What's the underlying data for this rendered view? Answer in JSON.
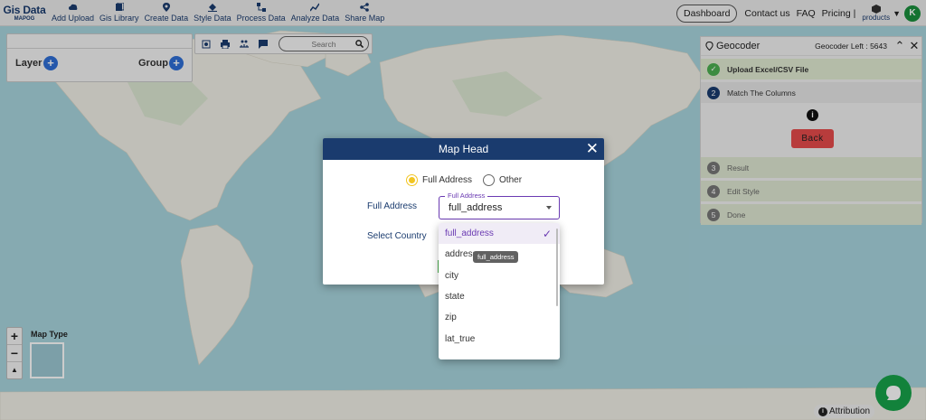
{
  "logo": {
    "line1": "Gis Data",
    "line2": "MAPOG"
  },
  "nav": [
    {
      "label": "Add Upload",
      "icon": "cloud-upload-icon"
    },
    {
      "label": "Gis Library",
      "icon": "library-icon"
    },
    {
      "label": "Create Data",
      "icon": "map-pin-icon"
    },
    {
      "label": "Style Data",
      "icon": "paint-bucket-icon"
    },
    {
      "label": "Process Data",
      "icon": "process-icon"
    },
    {
      "label": "Analyze Data",
      "icon": "analyze-icon"
    },
    {
      "label": "Share Map",
      "icon": "share-icon"
    }
  ],
  "topright": {
    "dashboard": "Dashboard",
    "contact": "Contact us",
    "faq": "FAQ",
    "pricing": "Pricing |",
    "products": "products",
    "avatar": "K"
  },
  "layer_panel": {
    "layer_label": "Layer",
    "group_label": "Group",
    "plus": "+"
  },
  "toolbar": {
    "search_placeholder": "Search"
  },
  "geocoder": {
    "title": "Geocoder",
    "left_label": "Geocoder Left : 5643",
    "steps": [
      {
        "num": "✓",
        "label": "Upload Excel/CSV File",
        "state": "done"
      },
      {
        "num": "2",
        "label": "Match The Columns",
        "state": "active"
      },
      {
        "num": "3",
        "label": "Result",
        "state": "pending"
      },
      {
        "num": "4",
        "label": "Edit Style",
        "state": "pending"
      },
      {
        "num": "5",
        "label": "Done",
        "state": "pending"
      }
    ],
    "info": "i",
    "back_label": "Back"
  },
  "map_controls": {
    "zoom_in": "+",
    "zoom_out": "−",
    "reset": "▲",
    "map_type_label": "Map Type",
    "attribution": "Attribution"
  },
  "modal": {
    "title": "Map Head",
    "close": "✕",
    "radio_full_address": "Full Address",
    "radio_other": "Other",
    "full_address_label": "Full Address",
    "select_country_label": "Select Country",
    "select_legend": "Full Address",
    "select_value": "full_address"
  },
  "dropdown": {
    "items": [
      "full_address",
      "address",
      "city",
      "state",
      "zip",
      "lat_true"
    ],
    "selected": "full_address",
    "tooltip": "full_address"
  },
  "colors": {
    "navy": "#1a3b6e",
    "accent_purple": "#6a3ab2",
    "back_red": "#e74c4c",
    "done_green": "#4caf50",
    "radio_yellow": "#f2c522"
  }
}
